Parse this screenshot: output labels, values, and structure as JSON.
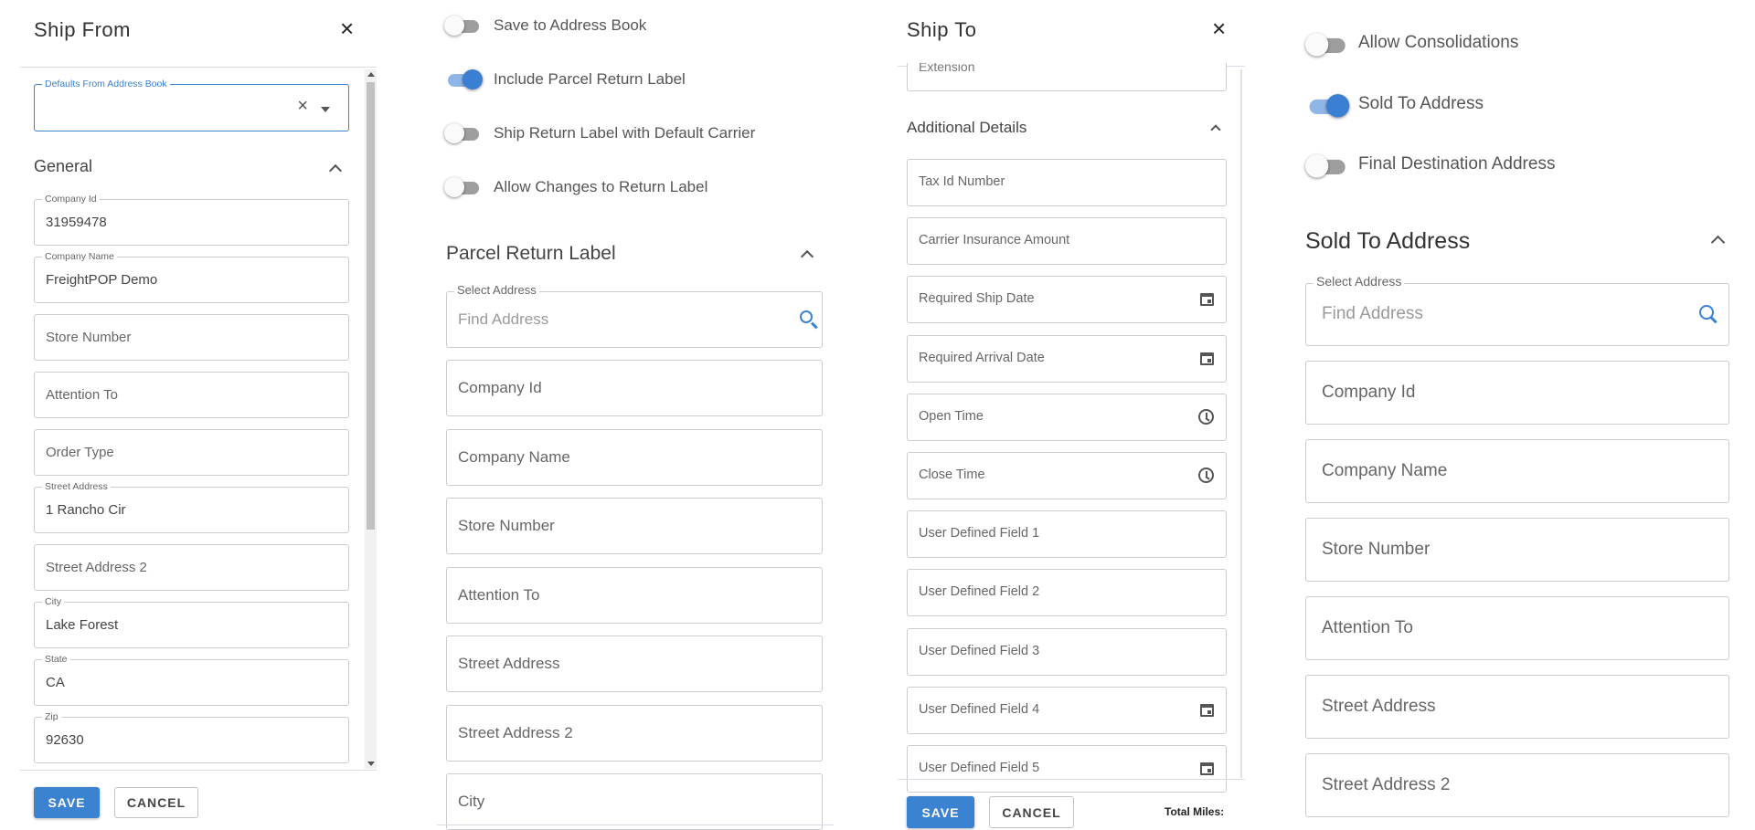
{
  "panel1": {
    "title": "Ship From",
    "defaults_label": "Defaults From Address Book",
    "section": "General",
    "fields": [
      {
        "label": "Company Id",
        "value": "31959478"
      },
      {
        "label": "Company Name",
        "value": "FreightPOP Demo"
      },
      {
        "placeholder": "Store Number"
      },
      {
        "placeholder": "Attention To"
      },
      {
        "placeholder": "Order Type"
      },
      {
        "label": "Street Address",
        "value": "1 Rancho Cir"
      },
      {
        "placeholder": "Street Address 2"
      },
      {
        "label": "City",
        "value": "Lake Forest"
      },
      {
        "label": "State",
        "value": "CA"
      },
      {
        "label": "Zip",
        "value": "92630"
      }
    ],
    "save": "SAVE",
    "cancel": "CANCEL"
  },
  "panel2": {
    "toggles": [
      {
        "label": "Save to Address Book",
        "on": false
      },
      {
        "label": "Include Parcel Return Label",
        "on": true
      },
      {
        "label": "Ship Return Label with Default Carrier",
        "on": false
      },
      {
        "label": "Allow Changes to Return Label",
        "on": false
      }
    ],
    "section": "Parcel Return Label",
    "select_address_label": "Select Address",
    "find_address_placeholder": "Find Address",
    "fields": [
      "Company Id",
      "Company Name",
      "Store Number",
      "Attention To",
      "Street Address",
      "Street Address 2",
      "City"
    ]
  },
  "panel3": {
    "title": "Ship To",
    "extension": "Extension",
    "section": "Additional Details",
    "fields": [
      {
        "placeholder": "Tax Id Number",
        "icon": ""
      },
      {
        "placeholder": "Carrier Insurance Amount",
        "icon": ""
      },
      {
        "placeholder": "Required Ship Date",
        "icon": "calendar-icon"
      },
      {
        "placeholder": "Required Arrival Date",
        "icon": "calendar-icon"
      },
      {
        "placeholder": "Open Time",
        "icon": "clock-icon"
      },
      {
        "placeholder": "Close Time",
        "icon": "clock-icon"
      },
      {
        "placeholder": "User Defined Field 1",
        "icon": ""
      },
      {
        "placeholder": "User Defined Field 2",
        "icon": ""
      },
      {
        "placeholder": "User Defined Field 3",
        "icon": ""
      },
      {
        "placeholder": "User Defined Field 4",
        "icon": "calendar-icon"
      },
      {
        "placeholder": "User Defined Field 5",
        "icon": "calendar-icon"
      }
    ],
    "save": "SAVE",
    "cancel": "CANCEL",
    "total_miles": "Total Miles:"
  },
  "panel4": {
    "toggles": [
      {
        "label": "Allow Consolidations",
        "on": false
      },
      {
        "label": "Sold To Address",
        "on": true
      },
      {
        "label": "Final Destination Address",
        "on": false
      }
    ],
    "section": "Sold To Address",
    "select_address_label": "Select Address",
    "find_address_placeholder": "Find Address",
    "fields": [
      "Company Id",
      "Company Name",
      "Store Number",
      "Attention To",
      "Street Address",
      "Street Address 2"
    ]
  },
  "colors": {
    "accent": "#3b82d0"
  }
}
